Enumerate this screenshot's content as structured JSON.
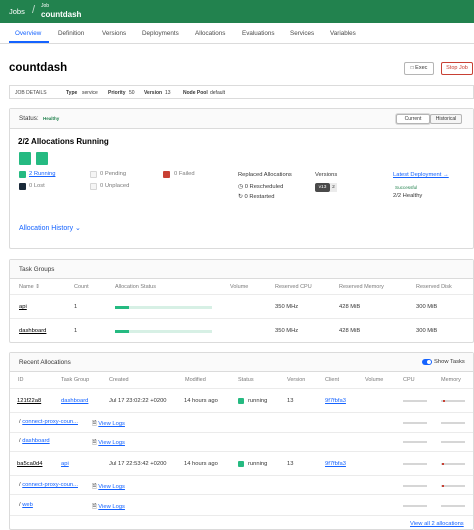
{
  "topbar": {
    "breadcrumb_jobs": "Jobs",
    "breadcrumb_sub": "Job",
    "job_name": "countdash"
  },
  "tabs": [
    "Overview",
    "Definition",
    "Versions",
    "Deployments",
    "Allocations",
    "Evaluations",
    "Services",
    "Variables"
  ],
  "header": {
    "title": "countdash",
    "exec_label": "Exec",
    "stop_label": "Stop Job"
  },
  "job_details": {
    "label": "JOB DETAILS",
    "type_label": "Type",
    "type_value": "service",
    "priority_label": "Priority",
    "priority_value": "50",
    "version_label": "Version",
    "version_value": "13",
    "node_pool_label": "Node Pool",
    "node_pool_value": "default"
  },
  "status": {
    "label": "Status:",
    "badge": "Healthy",
    "toggle_current": "Current",
    "toggle_historical": "Historical",
    "allocations_heading": "2/2 Allocations Running",
    "legend": {
      "running": "2 Running",
      "pending": "0 Pending",
      "failed": "0 Failed",
      "lost": "0 Lost",
      "unplaced": "0 Unplaced"
    },
    "replaced_heading": "Replaced Allocations",
    "rescheduled": "0 Rescheduled",
    "restarted": "0 Restarted",
    "versions_heading": "Versions",
    "version_badge": "v13",
    "version_count": "2",
    "deployment_link": "Latest Deployment →",
    "deployment_status": "Successful",
    "deployment_healthy": "2/2 Healthy",
    "history_link": "Allocation History"
  },
  "task_groups": {
    "title": "Task Groups",
    "headers": [
      "Name",
      "Count",
      "Allocation Status",
      "Volume",
      "Reserved CPU",
      "Reserved Memory",
      "Reserved Disk"
    ],
    "rows": [
      {
        "name": "api",
        "count": "1",
        "status_fraction": 0.14,
        "cpu": "350 MHz",
        "memory": "428 MiB",
        "disk": "300 MiB"
      },
      {
        "name": "dashboard",
        "count": "1",
        "status_fraction": 0.14,
        "cpu": "350 MHz",
        "memory": "428 MiB",
        "disk": "300 MiB"
      }
    ]
  },
  "recent_allocations": {
    "title": "Recent Allocations",
    "show_tasks": "Show Tasks",
    "headers": [
      "ID",
      "Task Group",
      "Created",
      "Modified",
      "Status",
      "Version",
      "Client",
      "Volume",
      "CPU",
      "Memory"
    ],
    "rows": [
      {
        "id": "121f22a8",
        "group": "dashboard",
        "created": "Jul 17 23:02:22 +0200",
        "modified": "14 hours ago",
        "status": "running",
        "version": "13",
        "client": "9f7fbfa3",
        "tasks": [
          {
            "name": "connect-proxy-coun...",
            "logs": "View Logs"
          },
          {
            "name": "dashboard",
            "logs": "View Logs"
          }
        ]
      },
      {
        "id": "ba5ca0d4",
        "group": "api",
        "created": "Jul 17 22:53:42 +0200",
        "modified": "14 hours ago",
        "status": "running",
        "version": "13",
        "client": "9f7fbfa3",
        "tasks": [
          {
            "name": "connect-proxy-coun...",
            "logs": "View Logs"
          },
          {
            "name": "web",
            "logs": "View Logs"
          }
        ]
      }
    ],
    "view_all": "View all 2 allocations"
  },
  "colors": {
    "brand": "#22824e",
    "running": "#25ba81",
    "failed": "#c84034",
    "link": "#1563ff",
    "lost": "#1a2a3a"
  }
}
